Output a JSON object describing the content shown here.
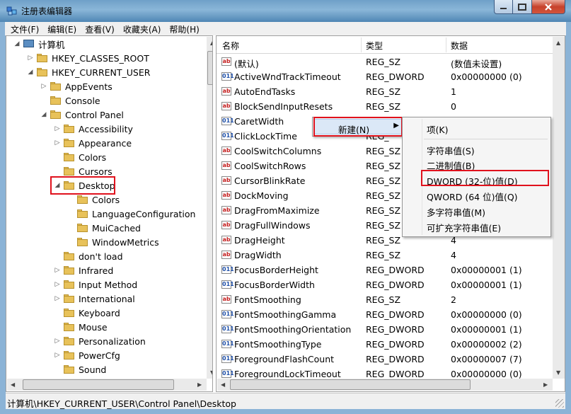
{
  "window": {
    "title": "注册表编辑器",
    "buttons": {
      "minimize": "—",
      "maximize": "□",
      "close": "✕"
    }
  },
  "menubar": [
    "文件(F)",
    "编辑(E)",
    "查看(V)",
    "收藏夹(A)",
    "帮助(H)"
  ],
  "tree": {
    "nodes": [
      {
        "label": "计算机",
        "expander": "◢",
        "icon": "computer-icon"
      },
      {
        "label": "HKEY_CLASSES_ROOT",
        "expander": "▷"
      },
      {
        "label": "HKEY_CURRENT_USER",
        "expander": "◢"
      },
      {
        "label": "AppEvents",
        "expander": "▷"
      },
      {
        "label": "Console",
        "expander": ""
      },
      {
        "label": "Control Panel",
        "expander": "◢"
      },
      {
        "label": "Accessibility",
        "expander": "▷"
      },
      {
        "label": "Appearance",
        "expander": "▷"
      },
      {
        "label": "Colors",
        "expander": ""
      },
      {
        "label": "Cursors",
        "expander": ""
      },
      {
        "label": "Desktop",
        "expander": "◢",
        "selected": true
      },
      {
        "label": "Colors",
        "expander": ""
      },
      {
        "label": "LanguageConfiguration",
        "expander": ""
      },
      {
        "label": "MuiCached",
        "expander": ""
      },
      {
        "label": "WindowMetrics",
        "expander": ""
      },
      {
        "label": "don't load",
        "expander": ""
      },
      {
        "label": "Infrared",
        "expander": "▷"
      },
      {
        "label": "Input Method",
        "expander": "▷"
      },
      {
        "label": "International",
        "expander": "▷"
      },
      {
        "label": "Keyboard",
        "expander": ""
      },
      {
        "label": "Mouse",
        "expander": ""
      },
      {
        "label": "Personalization",
        "expander": "▷"
      },
      {
        "label": "PowerCfg",
        "expander": "▷"
      },
      {
        "label": "Sound",
        "expander": ""
      }
    ]
  },
  "list": {
    "columns": [
      "名称",
      "类型",
      "数据"
    ],
    "rows": [
      {
        "name": "(默认)",
        "type": "REG_SZ",
        "data": "(数值未设置)",
        "icon": "ab"
      },
      {
        "name": "ActiveWndTrackTimeout",
        "type": "REG_DWORD",
        "data": "0x00000000 (0)",
        "icon": "011"
      },
      {
        "name": "AutoEndTasks",
        "type": "REG_SZ",
        "data": "1",
        "icon": "ab"
      },
      {
        "name": "BlockSendInputResets",
        "type": "REG_SZ",
        "data": "0",
        "icon": "ab"
      },
      {
        "name": "CaretWidth",
        "type": "",
        "data": "",
        "icon": "011"
      },
      {
        "name": "ClickLockTime",
        "type": "REG_",
        "data": "",
        "icon": "011"
      },
      {
        "name": "CoolSwitchColumns",
        "type": "REG_SZ",
        "data": "",
        "icon": "ab"
      },
      {
        "name": "CoolSwitchRows",
        "type": "REG_SZ",
        "data": "",
        "icon": "ab"
      },
      {
        "name": "CursorBlinkRate",
        "type": "REG_SZ",
        "data": "",
        "icon": "ab"
      },
      {
        "name": "DockMoving",
        "type": "REG_SZ",
        "data": "",
        "icon": "ab"
      },
      {
        "name": "DragFromMaximize",
        "type": "REG_SZ",
        "data": "",
        "icon": "ab"
      },
      {
        "name": "DragFullWindows",
        "type": "REG_SZ",
        "data": "",
        "icon": "ab"
      },
      {
        "name": "DragHeight",
        "type": "REG_SZ",
        "data": "4",
        "icon": "ab"
      },
      {
        "name": "DragWidth",
        "type": "REG_SZ",
        "data": "4",
        "icon": "ab"
      },
      {
        "name": "FocusBorderHeight",
        "type": "REG_DWORD",
        "data": "0x00000001 (1)",
        "icon": "011"
      },
      {
        "name": "FocusBorderWidth",
        "type": "REG_DWORD",
        "data": "0x00000001 (1)",
        "icon": "011"
      },
      {
        "name": "FontSmoothing",
        "type": "REG_SZ",
        "data": "2",
        "icon": "ab"
      },
      {
        "name": "FontSmoothingGamma",
        "type": "REG_DWORD",
        "data": "0x00000000 (0)",
        "icon": "011"
      },
      {
        "name": "FontSmoothingOrientation",
        "type": "REG_DWORD",
        "data": "0x00000001 (1)",
        "icon": "011"
      },
      {
        "name": "FontSmoothingType",
        "type": "REG_DWORD",
        "data": "0x00000002 (2)",
        "icon": "011"
      },
      {
        "name": "ForegroundFlashCount",
        "type": "REG_DWORD",
        "data": "0x00000007 (7)",
        "icon": "011"
      },
      {
        "name": "ForegroundLockTimeout",
        "type": "REG_DWORD",
        "data": "0x00000000 (0)",
        "icon": "011"
      }
    ]
  },
  "context_menu": {
    "parent_item": "新建(N)",
    "parent_arrow": "▶",
    "submenu": [
      {
        "label": "项(K)"
      },
      {
        "label": "字符串值(S)"
      },
      {
        "label": "二进制值(B)"
      },
      {
        "label": "DWORD (32-位)值(D)",
        "highlighted": true
      },
      {
        "label": "QWORD (64 位)值(Q)"
      },
      {
        "label": "多字符串值(M)"
      },
      {
        "label": "可扩充字符串值(E)"
      }
    ]
  },
  "statusbar": {
    "path": "计算机\\HKEY_CURRENT_USER\\Control Panel\\Desktop"
  },
  "colors": {
    "highlight_box": "#e0121d",
    "frame": "#8bb3d6",
    "menu_hover": "#dbe8f7"
  }
}
